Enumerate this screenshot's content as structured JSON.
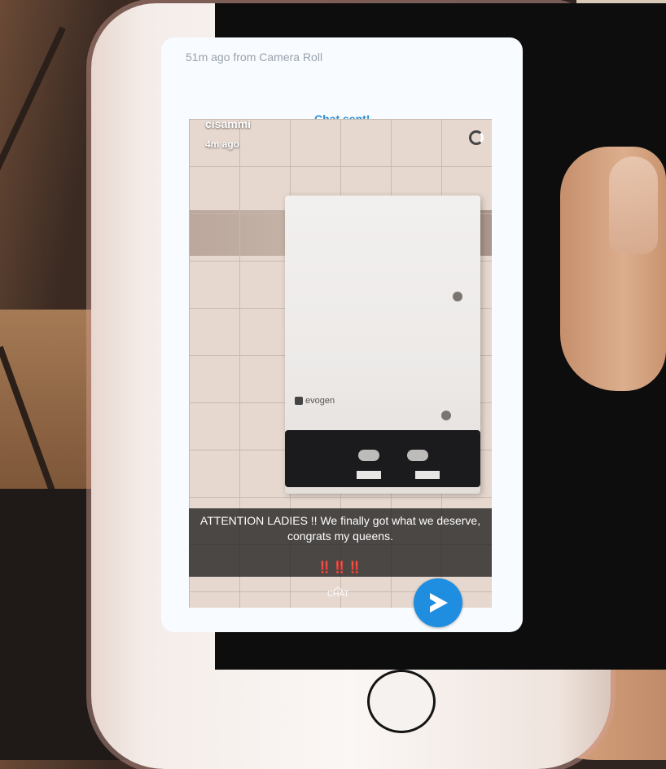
{
  "card": {
    "meta": "51m ago from Camera Roll",
    "status": "Chat sent!"
  },
  "snap": {
    "username": "cisammi",
    "time": "4m ago",
    "brand": "evogen",
    "caption": "ATTENTION LADIES !! We finally got what we deserve, congrats my queens.",
    "caption_emoji": "‼️‼️‼️",
    "chat_label": "CHAT"
  },
  "icons": {
    "timer": "timer-icon",
    "chat_chevron": "chevron-up-icon",
    "send": "send-arrow-icon"
  },
  "colors": {
    "accent": "#2e8fd3",
    "send_button": "#1f8ee0",
    "emoji_red": "#e02323"
  }
}
